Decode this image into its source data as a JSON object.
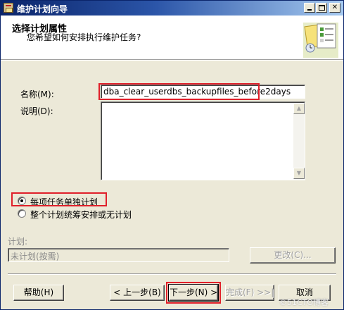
{
  "window": {
    "title": "维护计划向导"
  },
  "header": {
    "title": "选择计划属性",
    "subtitle": "您希望如何安排执行维护任务?",
    "art_icon": "wizard-folder-checklist-icon"
  },
  "form": {
    "name_label": "名称(M):",
    "name_value": "dba_clear_userdbs_backupfiles_before2days",
    "description_label": "说明(D):",
    "description_value": "",
    "radio_options": [
      {
        "label": "每项任务单独计划",
        "selected": true
      },
      {
        "label": "整个计划统筹安排或无计划",
        "selected": false
      }
    ],
    "schedule_label": "计划:",
    "schedule_value": "未计划(按需)",
    "change_button": "更改(C)..."
  },
  "buttons": {
    "help": "帮助(H)",
    "back": "< 上一步(B)",
    "next": "下一步(N) >",
    "finish": "完成(F) >>|",
    "cancel": "取消"
  },
  "watermark": "©51CTO博客",
  "colors": {
    "highlight": "#e0202a",
    "titlebar": "#0a246a"
  }
}
